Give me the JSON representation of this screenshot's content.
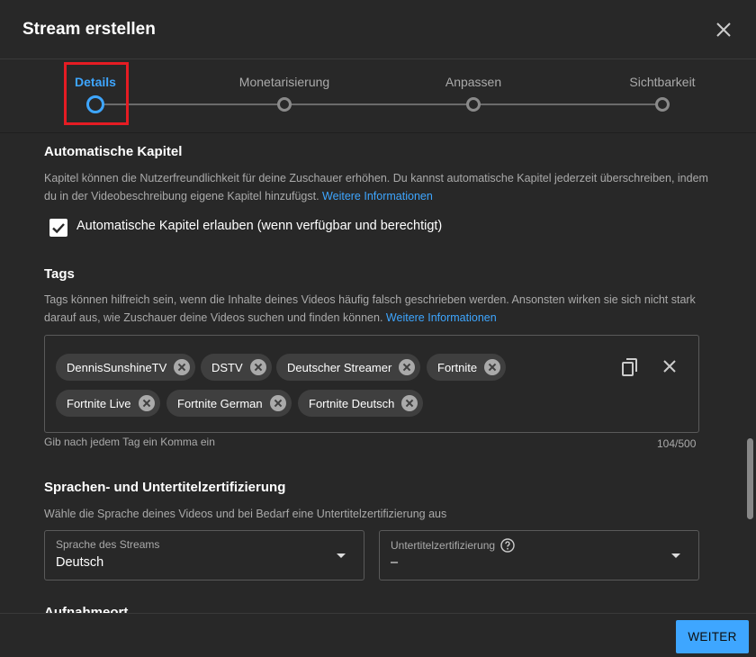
{
  "dialog": {
    "title": "Stream erstellen"
  },
  "stepper": {
    "steps": [
      {
        "label": "Details"
      },
      {
        "label": "Monetarisierung"
      },
      {
        "label": "Anpassen"
      },
      {
        "label": "Sichtbarkeit"
      }
    ]
  },
  "chapters": {
    "title": "Automatische Kapitel",
    "description": "Kapitel können die Nutzerfreundlichkeit für deine Zuschauer erhöhen. Du kannst automatische Kapitel jederzeit überschreiben, indem du in der Videobeschreibung eigene Kapitel hinzufügst.",
    "link": "Weitere Informationen",
    "checkbox_label": "Automatische Kapitel erlauben (wenn verfügbar und berechtigt)"
  },
  "tags": {
    "title": "Tags",
    "description": "Tags können hilfreich sein, wenn die Inhalte deines Videos häufig falsch geschrieben werden. Ansonsten wirken sie sich nicht stark darauf aus, wie Zuschauer deine Videos suchen und finden können.",
    "link": "Weitere Informationen",
    "items": [
      "DennisSunshineTV",
      "DSTV",
      "Deutscher Streamer",
      "Fortnite",
      "Fortnite Live",
      "Fortnite German",
      "Fortnite Deutsch"
    ],
    "hint": "Gib nach jedem Tag ein Komma ein",
    "counter": "104/500"
  },
  "language": {
    "title": "Sprachen- und Untertitelzertifizierung",
    "description": "Wähle die Sprache deines Videos und bei Bedarf eine Untertitelzertifizierung aus",
    "stream_language_label": "Sprache des Streams",
    "stream_language_value": "Deutsch",
    "caption_cert_label": "Untertitelzertifizierung",
    "caption_cert_value": "–"
  },
  "next_section": {
    "title": "Aufnahmeort"
  },
  "footer": {
    "next_label": "WEITER"
  },
  "colors": {
    "accent": "#3ea6ff",
    "background": "#282828",
    "highlight": "#e51c23"
  }
}
